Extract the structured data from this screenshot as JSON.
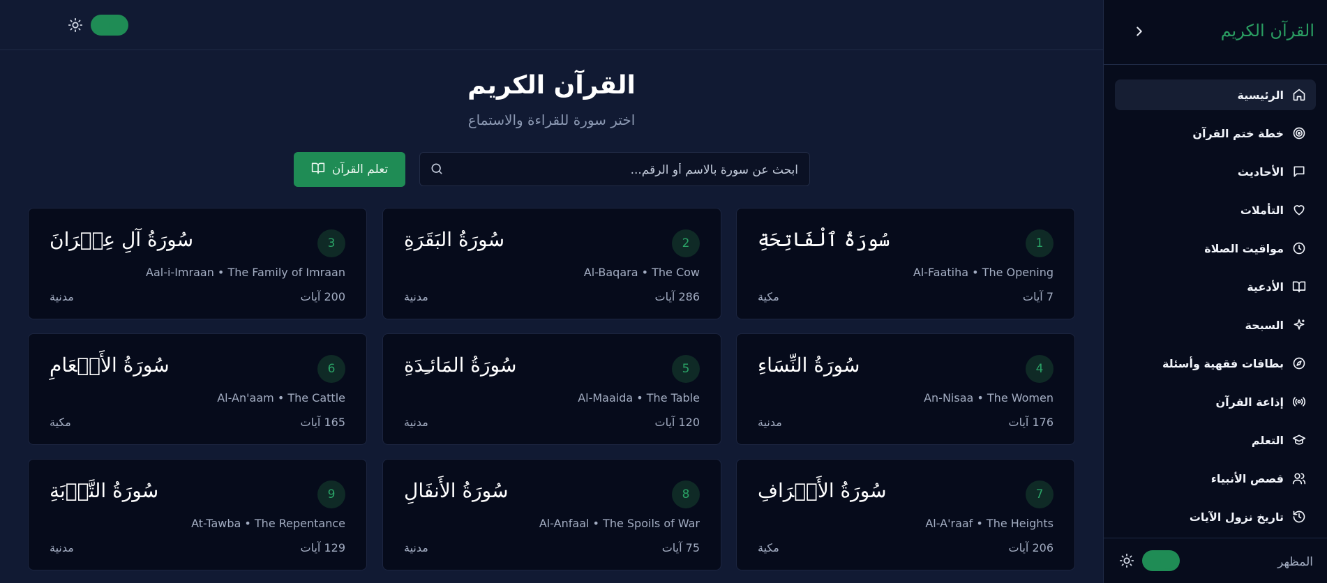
{
  "header": {
    "theme_icon": "sun-icon",
    "toggle_state": "on"
  },
  "main": {
    "title": "القرآن الكريم",
    "subtitle": "اختر سورة للقراءة والاستماع",
    "search": {
      "placeholder": "ابحث عن سورة بالاسم أو الرقم...",
      "value": ""
    },
    "learn_button": "تعلم القرآن"
  },
  "surahs": [
    {
      "number": "1",
      "arabic": "سُورَةُ ٱلْفَاتِحَةِ",
      "translit": "Al-Faatiha • The Opening",
      "ayat": "7 آيات",
      "type": "مكية"
    },
    {
      "number": "2",
      "arabic": "سُورَةُ البَقَرَةِ",
      "translit": "Al-Baqara • The Cow",
      "ayat": "286 آيات",
      "type": "مدنية"
    },
    {
      "number": "3",
      "arabic": "سُورَةُ آلِ عِمۡرَانَ",
      "translit": "Aal-i-Imraan • The Family of Imraan",
      "ayat": "200 آيات",
      "type": "مدنية"
    },
    {
      "number": "4",
      "arabic": "سُورَةُ النِّسَاءِ",
      "translit": "An-Nisaa • The Women",
      "ayat": "176 آيات",
      "type": "مدنية"
    },
    {
      "number": "5",
      "arabic": "سُورَةُ المَائـِدَةِ",
      "translit": "Al-Maaida • The Table",
      "ayat": "120 آيات",
      "type": "مدنية"
    },
    {
      "number": "6",
      "arabic": "سُورَةُ الأَنۡعَامِ",
      "translit": "Al-An'aam • The Cattle",
      "ayat": "165 آيات",
      "type": "مكية"
    },
    {
      "number": "7",
      "arabic": "سُورَةُ الأَعۡرَافِ",
      "translit": "Al-A'raaf • The Heights",
      "ayat": "206 آيات",
      "type": "مكية"
    },
    {
      "number": "8",
      "arabic": "سُورَةُ الأَنفَالِ",
      "translit": "Al-Anfaal • The Spoils of War",
      "ayat": "75 آيات",
      "type": "مدنية"
    },
    {
      "number": "9",
      "arabic": "سُورَةُ التَّوۡبَةِ",
      "translit": "At-Tawba • The Repentance",
      "ayat": "129 آيات",
      "type": "مدنية"
    }
  ],
  "sidebar": {
    "logo": "القرآن الكريم",
    "collapse_icon": "chevron-right-icon",
    "items": [
      {
        "label": "الرئيسية",
        "icon": "home-icon",
        "active": true
      },
      {
        "label": "خطة ختم القرآن",
        "icon": "target-icon"
      },
      {
        "label": "الأحاديث",
        "icon": "message-icon"
      },
      {
        "label": "التأملات",
        "icon": "heart-icon"
      },
      {
        "label": "مواقيت الصلاة",
        "icon": "clock-icon"
      },
      {
        "label": "الأدعية",
        "icon": "book-open-icon"
      },
      {
        "label": "السبحة",
        "icon": "sparkles-icon"
      },
      {
        "label": "بطاقات فقهية وأسئلة",
        "icon": "compass-icon"
      },
      {
        "label": "إذاعة القرآن",
        "icon": "radio-icon"
      },
      {
        "label": "التعلم",
        "icon": "graduation-cap-icon"
      },
      {
        "label": "قصص الأنبياء",
        "icon": "users-icon"
      },
      {
        "label": "تاريخ نزول الآيات",
        "icon": "history-icon"
      }
    ],
    "footer_label": "المظهر"
  },
  "colors": {
    "accent": "#1f8c55",
    "background": "#111a33",
    "card": "#060b1b",
    "sidebar": "#070c1c"
  }
}
